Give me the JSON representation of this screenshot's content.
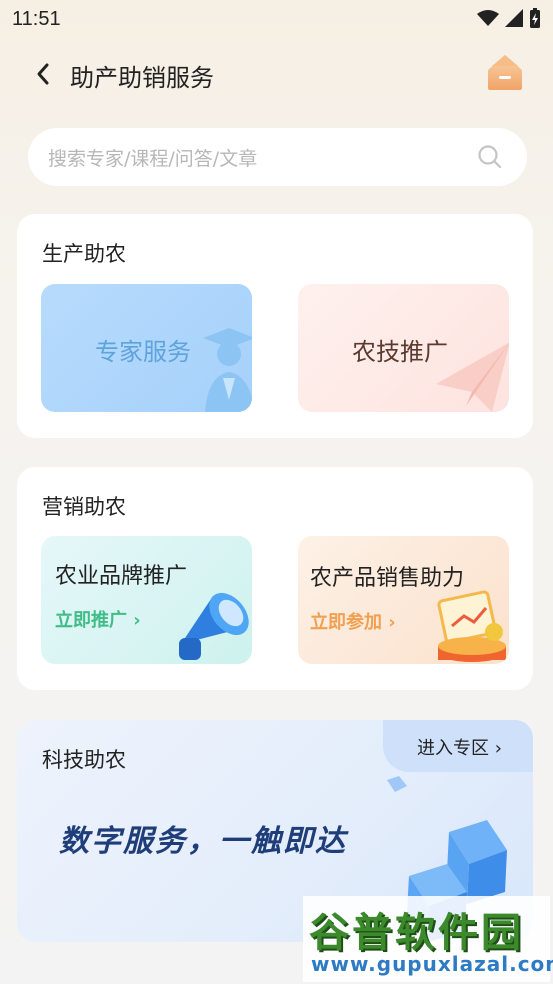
{
  "status_bar": {
    "time": "11:51"
  },
  "header": {
    "title": "助产助销服务"
  },
  "search": {
    "placeholder": "搜索专家/课程/问答/文章"
  },
  "production": {
    "title": "生产助农",
    "tiles": [
      {
        "label": "专家服务",
        "color": "#5ea3dc",
        "bg": "#b8dcfc"
      },
      {
        "label": "农技推广",
        "color": "#5a3a2f",
        "bg": "#fde8e4"
      }
    ]
  },
  "marketing": {
    "title": "营销助农",
    "tiles": [
      {
        "label": "农业品牌推广",
        "action": "立即推广 ›",
        "action_color": "#3fbd86"
      },
      {
        "label": "农产品销售助力",
        "action": "立即参加 ›",
        "action_color": "#f0a050"
      }
    ]
  },
  "tech": {
    "title": "科技助农",
    "enter_label": "进入专区 ›",
    "slogan": "数字服务，一触即达"
  },
  "watermark": {
    "name": "谷普软件园",
    "url": "www.gupuxlazal.com"
  }
}
